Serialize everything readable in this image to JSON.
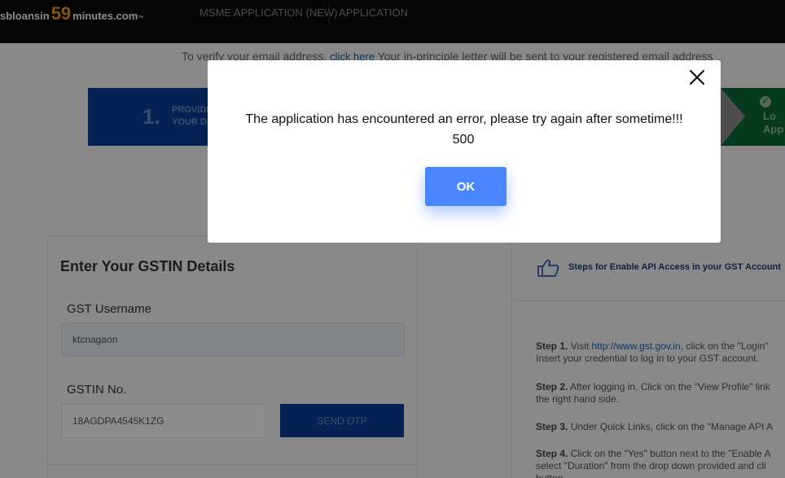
{
  "header": {
    "logo": {
      "part1": "sbloansin",
      "part2": "59",
      "part3": "minutes.com",
      "trademark": "™"
    },
    "nav": [
      {
        "label": "MSME APPLICATION (NEW)"
      },
      {
        "label": "APPLICATION"
      }
    ]
  },
  "info": {
    "prefix": "To verify your email address,",
    "link": "click here",
    "suffix": "Your in-principle letter will be sent to your registered email address"
  },
  "steps": {
    "step1": {
      "number": "1.",
      "text": "PROVIDE\nYOUR DA"
    },
    "step3": {
      "text": "Lo\nApp"
    }
  },
  "gstin_form": {
    "title": "Enter Your GSTIN Details",
    "username_label": "GST Username",
    "username_value": "ktcnagaon",
    "gstin_label": "GSTIN No.",
    "gstin_value": "18AGDPA4545K1ZG",
    "send_otp_label": "SEND OTP"
  },
  "api_panel": {
    "title": "Steps for Enable API Access in your GST Account",
    "steps": [
      {
        "label": "Step 1.",
        "text_a": " Visit ",
        "link": "http://www.gst.gov.in",
        "text_b": ", click on the \"Login\"\nInsert your credential to log in to your GST account."
      },
      {
        "label": "Step 2.",
        "text": " After logging in, Click on the \"View Profile\" link\nthe right hand side."
      },
      {
        "label": "Step 3.",
        "text": " Under Quick Links, click on the \"Manage API A"
      },
      {
        "label": "Step 4.",
        "text": " Click on the \"Yes\" button next to the \"Enable A\nselect \"Duration\" from the drop down provided and cli\nbutton."
      }
    ]
  },
  "modal": {
    "message": "The application has encountered an error, please try again after sometime!!!",
    "code": "500",
    "ok_label": "OK"
  },
  "colors": {
    "primary_blue": "#0b3f9a",
    "ok_button": "#4a86ff",
    "step_green": "#0b6b3a",
    "logo_orange": "#f39c12"
  }
}
